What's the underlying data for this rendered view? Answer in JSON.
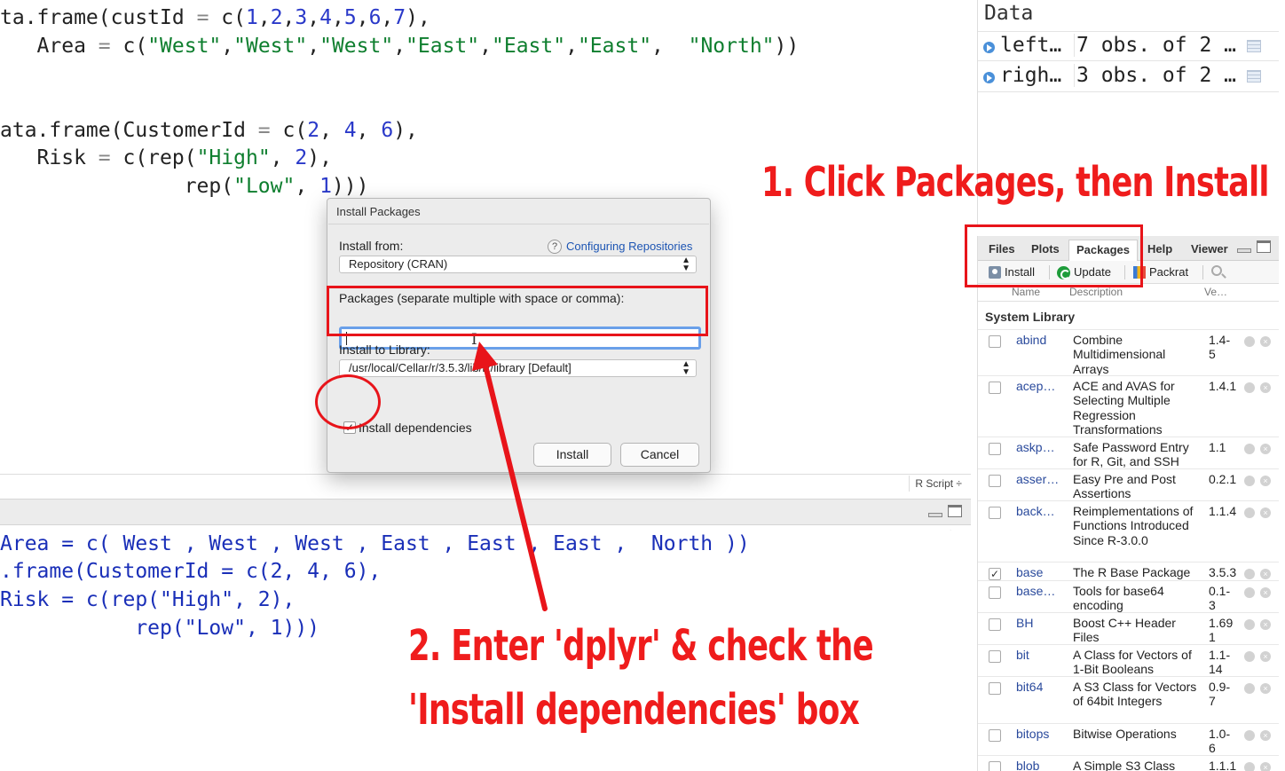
{
  "editor": {
    "lines": [
      {
        "segments": [
          [
            "ta.frame(custId ",
            ""
          ],
          [
            "=",
            "op"
          ],
          [
            " c(",
            ""
          ],
          [
            "1",
            "num"
          ],
          [
            ",",
            ""
          ],
          [
            "2",
            "num"
          ],
          [
            ",",
            ""
          ],
          [
            "3",
            "num"
          ],
          [
            ",",
            ""
          ],
          [
            "4",
            "num"
          ],
          [
            ",",
            ""
          ],
          [
            "5",
            "num"
          ],
          [
            ",",
            ""
          ],
          [
            "6",
            "num"
          ],
          [
            ",",
            ""
          ],
          [
            "7",
            "num"
          ],
          [
            "),",
            ""
          ]
        ]
      },
      {
        "segments": [
          [
            "   Area ",
            ""
          ],
          [
            "=",
            "op"
          ],
          [
            " c(",
            ""
          ],
          [
            "\"West\"",
            "str"
          ],
          [
            ",",
            ""
          ],
          [
            "\"West\"",
            "str"
          ],
          [
            ",",
            ""
          ],
          [
            "\"West\"",
            "str"
          ],
          [
            ",",
            ""
          ],
          [
            "\"East\"",
            "str"
          ],
          [
            ",",
            ""
          ],
          [
            "\"East\"",
            "str"
          ],
          [
            ",",
            ""
          ],
          [
            "\"East\"",
            "str"
          ],
          [
            ",  ",
            ""
          ],
          [
            "\"North\"",
            "str"
          ],
          [
            "))",
            ""
          ]
        ]
      },
      {
        "segments": [
          [
            "ata.frame(CustomerId ",
            ""
          ],
          [
            "=",
            "op"
          ],
          [
            " c(",
            ""
          ],
          [
            "2",
            "num"
          ],
          [
            ", ",
            ""
          ],
          [
            "4",
            "num"
          ],
          [
            ", ",
            ""
          ],
          [
            "6",
            "num"
          ],
          [
            "),",
            ""
          ]
        ]
      },
      {
        "segments": [
          [
            "   Risk ",
            ""
          ],
          [
            "=",
            "op"
          ],
          [
            " c(rep(",
            ""
          ],
          [
            "\"High\"",
            "str"
          ],
          [
            ", ",
            ""
          ],
          [
            "2",
            "num"
          ],
          [
            "),",
            ""
          ]
        ]
      },
      {
        "segments": [
          [
            "               rep(",
            ""
          ],
          [
            "\"Low\"",
            "str"
          ],
          [
            ", ",
            ""
          ],
          [
            "1",
            "num"
          ],
          [
            ")))",
            ""
          ]
        ]
      }
    ],
    "file_type": "R Script ÷"
  },
  "console": {
    "lines": [
      "Area = c( West , West , West , East , East , East ,  North ))",
      ".frame(CustomerId = c(2, 4, 6),",
      "Risk = c(rep(\"High\", 2),",
      "           rep(\"Low\", 1)))"
    ]
  },
  "environment": {
    "title": "Data",
    "rows": [
      {
        "name": "left…",
        "value": "7 obs. of 2 …"
      },
      {
        "name": "righ…",
        "value": "3 obs. of 2 …"
      }
    ]
  },
  "packages_pane": {
    "tabs": [
      "Files",
      "Plots",
      "Packages",
      "Help",
      "Viewer"
    ],
    "active_tab": "Packages",
    "toolbar": {
      "install": "Install",
      "update": "Update",
      "packrat": "Packrat"
    },
    "columns": {
      "name": "Name",
      "description": "Description",
      "version": "Ve…"
    },
    "section": "System Library",
    "rows": [
      {
        "checked": false,
        "name": "abind",
        "desc": "Combine Multidimensional Arrays",
        "ver": "1.4-\n5"
      },
      {
        "checked": false,
        "name": "acep…",
        "desc": "ACE and AVAS for Selecting Multiple Regression Transformations",
        "ver": "1.4.1"
      },
      {
        "checked": false,
        "name": "askp…",
        "desc": "Safe Password Entry for R, Git, and SSH",
        "ver": "1.1"
      },
      {
        "checked": false,
        "name": "asser…",
        "desc": "Easy Pre and Post Assertions",
        "ver": "0.2.1"
      },
      {
        "checked": false,
        "name": "back…",
        "desc": "Reimplementations of Functions Introduced Since R-3.0.0",
        "ver": "1.1.4"
      },
      {
        "checked": true,
        "name": "base",
        "desc": "The R Base Package",
        "ver": "3.5.3"
      },
      {
        "checked": false,
        "name": "base…",
        "desc": "Tools for base64 encoding",
        "ver": "0.1-\n3"
      },
      {
        "checked": false,
        "name": "BH",
        "desc": "Boost C++ Header Files",
        "ver": "1.69\n1"
      },
      {
        "checked": false,
        "name": "bit",
        "desc": "A Class for Vectors of 1-Bit Booleans",
        "ver": "1.1-\n14"
      },
      {
        "checked": false,
        "name": "bit64",
        "desc": "A S3 Class for Vectors of 64bit Integers",
        "ver": "0.9-\n7"
      },
      {
        "checked": false,
        "name": "bitops",
        "desc": "Bitwise Operations",
        "ver": "1.0-\n6"
      },
      {
        "checked": false,
        "name": "blob",
        "desc": "A Simple S3 Class",
        "ver": "1.1.1"
      }
    ]
  },
  "dialog": {
    "title": "Install Packages",
    "install_from_label": "Install from:",
    "help_icon": "?",
    "configuring_link": "Configuring Repositories",
    "install_from_value": "Repository (CRAN)",
    "packages_label": "Packages (separate multiple with space or comma):",
    "packages_value": "",
    "install_to_label": "Install to Library:",
    "install_to_value": "/usr/local/Cellar/r/3.5.3/lib/R/library [Default]",
    "dependencies_label": "Install dependencies",
    "dependencies_checked": true,
    "install_button": "Install",
    "cancel_button": "Cancel"
  },
  "annotations": {
    "step1": "1. Click Packages, then Install",
    "step2_line1": "2. Enter 'dplyr' & check the",
    "step2_line2": "'Install dependencies' box",
    "color": "#ef1c1c"
  }
}
